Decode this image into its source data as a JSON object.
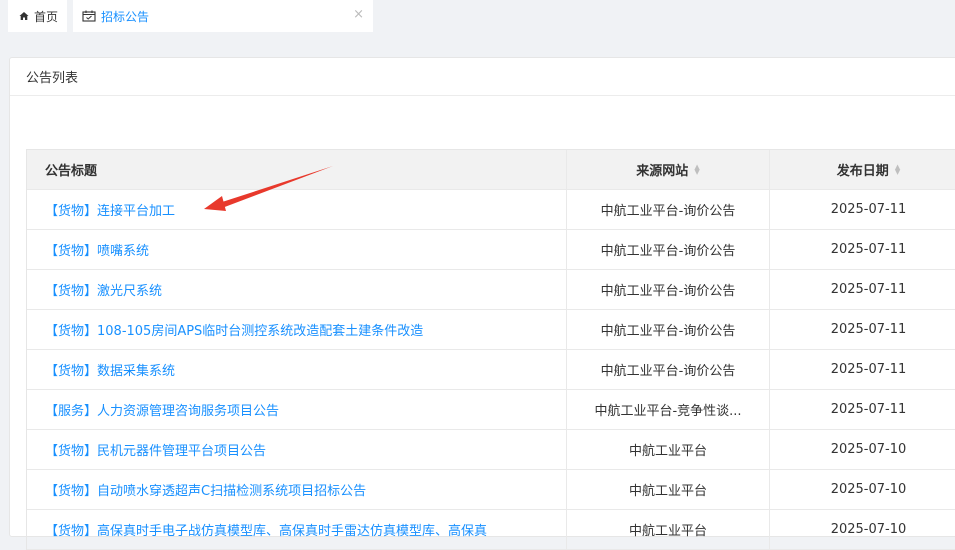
{
  "tabs": {
    "home_label": "首页",
    "active_label": "招标公告",
    "close_glyph": "×"
  },
  "card": {
    "title": "公告列表"
  },
  "table": {
    "headers": {
      "title": "公告标题",
      "source": "来源网站",
      "date": "发布日期"
    },
    "rows": [
      {
        "title": "【货物】连接平台加工",
        "source": "中航工业平台-询价公告",
        "date": "2025-07-11"
      },
      {
        "title": "【货物】喷嘴系统",
        "source": "中航工业平台-询价公告",
        "date": "2025-07-11"
      },
      {
        "title": "【货物】激光尺系统",
        "source": "中航工业平台-询价公告",
        "date": "2025-07-11"
      },
      {
        "title": "【货物】108-105房间APS临时台测控系统改造配套土建条件改造",
        "source": "中航工业平台-询价公告",
        "date": "2025-07-11"
      },
      {
        "title": "【货物】数据采集系统",
        "source": "中航工业平台-询价公告",
        "date": "2025-07-11"
      },
      {
        "title": "【服务】人力资源管理咨询服务项目公告",
        "source": "中航工业平台-竞争性谈...",
        "date": "2025-07-11"
      },
      {
        "title": "【货物】民机元器件管理平台项目公告",
        "source": "中航工业平台",
        "date": "2025-07-10"
      },
      {
        "title": "【货物】自动喷水穿透超声C扫描检测系统项目招标公告",
        "source": "中航工业平台",
        "date": "2025-07-10"
      },
      {
        "title": "【货物】高保真时手电子战仿真模型库、高保真时手雷达仿真模型库、高保真",
        "source": "中航工业平台",
        "date": "2025-07-10"
      }
    ]
  },
  "colors": {
    "accent": "#1890ff",
    "annotation_arrow": "#e8392c"
  },
  "icons": {
    "home": "home-icon",
    "calendar": "calendar-icon",
    "sort": "sort-icon"
  }
}
